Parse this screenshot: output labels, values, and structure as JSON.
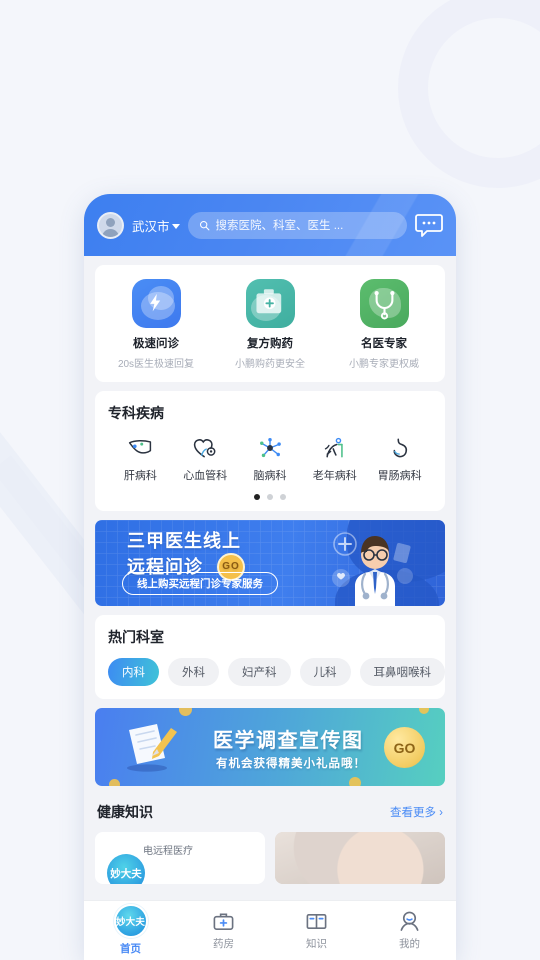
{
  "header": {
    "city": "武汉市",
    "search_placeholder": "搜索医院、科室、医生 ...",
    "search_icon": "search-icon",
    "chat_icon": "chat-bubble-icon",
    "avatar_icon": "user-avatar"
  },
  "services": [
    {
      "title": "极速问诊",
      "subtitle": "20s医生极速回复",
      "icon": "lightning-cloud-icon",
      "color": "#4a8df5"
    },
    {
      "title": "复方购药",
      "subtitle": "小鹏购药更安全",
      "icon": "medical-kit-plus-icon",
      "color": "#52bfb0"
    },
    {
      "title": "名医专家",
      "subtitle": "小鹏专家更权威",
      "icon": "stethoscope-shield-icon",
      "color": "#5cbd6e"
    }
  ],
  "specialty": {
    "title": "专科疾病",
    "items": [
      {
        "label": "肝病科",
        "icon": "liver-icon"
      },
      {
        "label": "心血管科",
        "icon": "heart-vessel-icon"
      },
      {
        "label": "脑病科",
        "icon": "brain-neuron-icon"
      },
      {
        "label": "老年病科",
        "icon": "elderly-person-icon"
      },
      {
        "label": "胃肠病科",
        "icon": "stomach-icon"
      }
    ],
    "page_count": 3,
    "active_page": 1
  },
  "doctor_banner": {
    "line1": "三甲医生线上",
    "line2": "远程问诊",
    "go_label": "GO",
    "pill_text": "线上购买远程门诊专家服务"
  },
  "hot": {
    "title": "热门科室",
    "pills": [
      "内科",
      "外科",
      "妇产科",
      "儿科",
      "耳鼻咽喉科"
    ],
    "active_pill": "内科"
  },
  "survey_banner": {
    "title": "医学调查宣传图",
    "subtitle": "有机会获得精美小礼品哦！",
    "go_label": "GO"
  },
  "knowledge": {
    "title": "健康知识",
    "more_label": "查看更多",
    "more_icon": "chevron-right-icon",
    "cards": [
      {
        "caption": "电远程医疗",
        "logo_text": "妙大夫"
      },
      {
        "caption": ""
      }
    ]
  },
  "bottom_nav": {
    "items": [
      {
        "label": "首页",
        "icon": "app-logo-icon",
        "logo_text": "妙大夫",
        "active": true
      },
      {
        "label": "药房",
        "icon": "medical-kit-icon",
        "active": false
      },
      {
        "label": "知识",
        "icon": "open-book-icon",
        "active": false
      },
      {
        "label": "我的",
        "icon": "user-profile-icon",
        "active": false
      }
    ]
  }
}
